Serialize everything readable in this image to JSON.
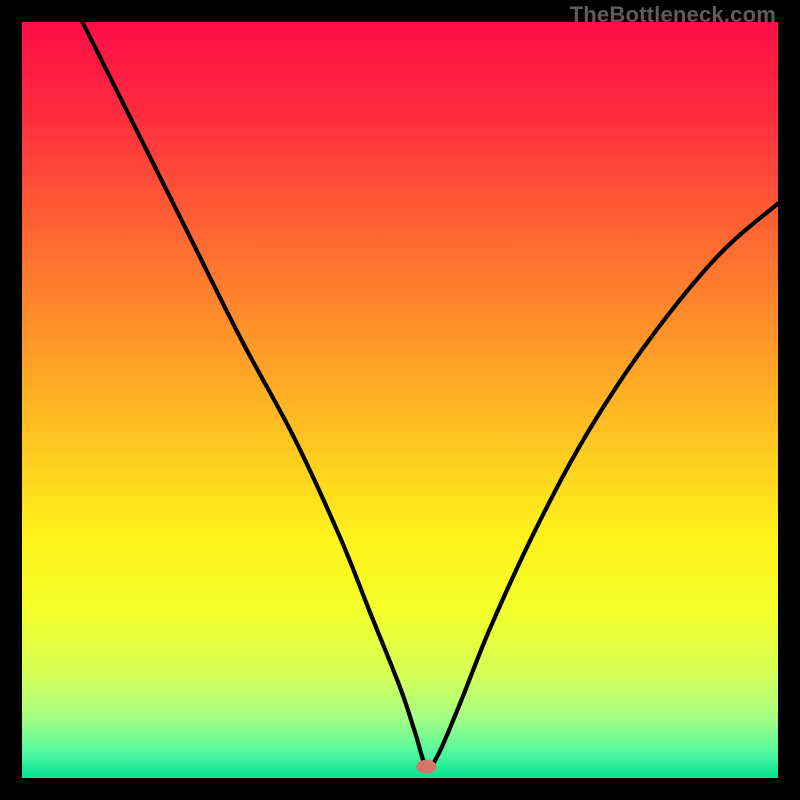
{
  "attribution": "TheBottleneck.com",
  "chart_data": {
    "type": "line",
    "title": "",
    "xlabel": "",
    "ylabel": "",
    "xlim": [
      0,
      100
    ],
    "ylim": [
      0,
      100
    ],
    "grid": false,
    "legend": false,
    "series": [
      {
        "name": "bottleneck-curve",
        "x": [
          8,
          15,
          22,
          29,
          36,
          42,
          46,
          50,
          52,
          53.5,
          55,
          58,
          62,
          68,
          75,
          83,
          92,
          100
        ],
        "y": [
          100,
          86,
          72,
          58,
          45,
          32,
          22,
          12,
          6,
          1.5,
          3,
          10,
          20,
          33,
          46,
          58,
          69,
          76
        ]
      }
    ],
    "marker": {
      "x": 53.5,
      "y": 1.5
    },
    "background": {
      "type": "vertical-gradient",
      "stops": [
        {
          "pos": 0.0,
          "color": "#ff0e47"
        },
        {
          "pos": 0.12,
          "color": "#ff2b3f"
        },
        {
          "pos": 0.25,
          "color": "#ff5b34"
        },
        {
          "pos": 0.4,
          "color": "#ff8f2a"
        },
        {
          "pos": 0.55,
          "color": "#ffc421"
        },
        {
          "pos": 0.68,
          "color": "#fff21a"
        },
        {
          "pos": 0.78,
          "color": "#f3ff2a"
        },
        {
          "pos": 0.86,
          "color": "#d7ff55"
        },
        {
          "pos": 0.92,
          "color": "#a6ff84"
        },
        {
          "pos": 0.97,
          "color": "#4bf6a0"
        },
        {
          "pos": 1.0,
          "color": "#02e28e"
        }
      ]
    }
  }
}
